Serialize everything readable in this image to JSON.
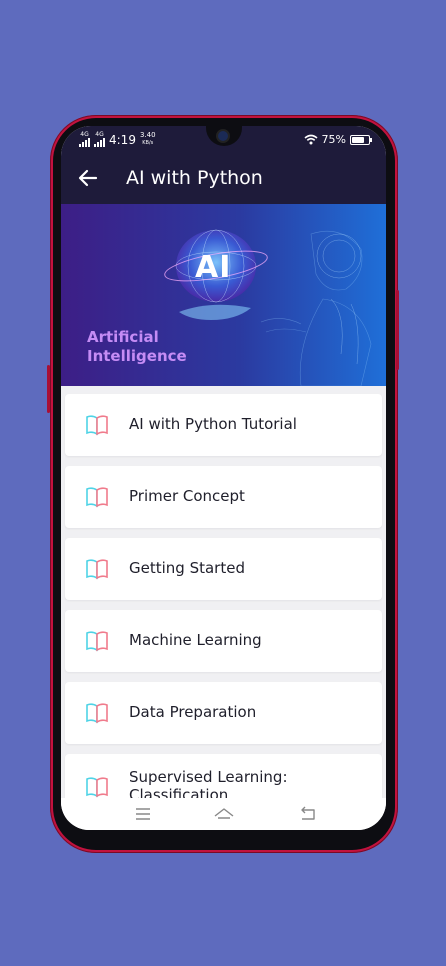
{
  "status_bar": {
    "network_1": "4G",
    "network_2": "4G",
    "time": "4:19",
    "speed_value": "3.40",
    "speed_unit": "KB/s",
    "battery_percent": "75%",
    "battery_level": 0.75
  },
  "app_bar": {
    "title": "AI with Python",
    "back_icon": "arrow-left-icon"
  },
  "banner": {
    "badge_text": "AI",
    "caption_line1": "Artificial",
    "caption_line2": "Intelligence"
  },
  "topics": [
    {
      "label": "AI with Python Tutorial",
      "icon": "book-icon"
    },
    {
      "label": "Primer Concept",
      "icon": "book-icon"
    },
    {
      "label": "Getting Started",
      "icon": "book-icon"
    },
    {
      "label": "Machine Learning",
      "icon": "book-icon"
    },
    {
      "label": "Data Preparation",
      "icon": "book-icon"
    },
    {
      "label": "Supervised Learning:",
      "label_line2": "Classification",
      "icon": "book-icon"
    }
  ],
  "nav_bar": {
    "menu_icon": "menu-icon",
    "home_icon": "home-icon",
    "back_icon": "back-icon"
  },
  "colors": {
    "background": "#5e6bbe",
    "phone_frame": "#c2123e",
    "app_bar": "#1e1b3a",
    "banner_text": "#c58cf5",
    "book_blue": "#4fd3e6",
    "book_red": "#f07b8c"
  }
}
